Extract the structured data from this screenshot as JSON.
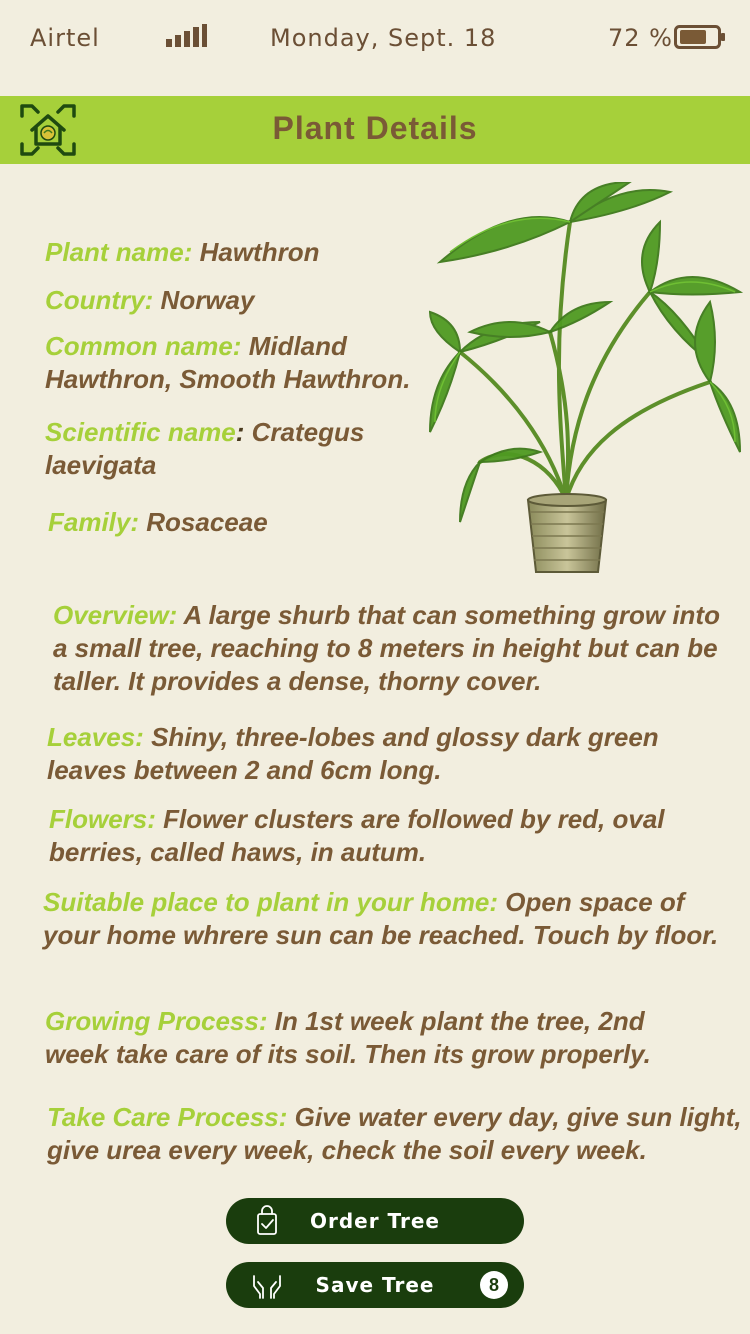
{
  "status_bar": {
    "carrier": "Airtel",
    "date": "Monday, Sept. 18",
    "battery": "72 %",
    "signal_icon": "signal-bars-icon",
    "battery_icon": "battery-icon"
  },
  "header": {
    "title": "Plant Details",
    "icon": "home-scan-icon"
  },
  "plant": {
    "image": "potted-palm-plant"
  },
  "details": {
    "name_label": "Plant name:",
    "name_value": " Hawthron",
    "country_label": "Country:",
    "country_value": " Norway",
    "common_label": "Common name:",
    "common_value": " Midland Hawthron, Smooth Hawthron.",
    "scientific_label": "Scientific name",
    "scientific_colon": ":",
    "scientific_value": " Crategus laevigata",
    "family_label": "Family:",
    "family_value": " Rosaceae",
    "overview_label": "Overview:",
    "overview_value": " A large shurb that can something grow into a small tree, reaching to 8 meters in height but can be taller. It provides a dense, thorny cover.",
    "leaves_label": "Leaves:",
    "leaves_value": " Shiny, three-lobes and glossy dark green leaves between 2 and 6cm long.",
    "flowers_label": "Flowers:",
    "flowers_value": " Flower clusters are followed by red, oval berries, called haws, in autum.",
    "place_label": "Suitable place to plant in your home:",
    "place_value": " Open space of your home whrere sun can be reached. Touch by floor.",
    "growing_label": "Growing Process:",
    "growing_value": " In 1st week plant the tree, 2nd week take care of its soil. Then its grow properly.",
    "care_label": "Take Care Process:",
    "care_value": " Give water every day, give sun light, give urea every week, check the soil every week."
  },
  "actions": {
    "order_label": "Order Tree",
    "order_icon": "shopping-bag-icon",
    "save_label": "Save Tree",
    "save_icon": "hands-icon",
    "save_count": "8"
  },
  "colors": {
    "background": "#f2eedf",
    "header": "#a6d03a",
    "label": "#a6d03a",
    "text": "#7a5a36",
    "button": "#1a3d0d"
  }
}
